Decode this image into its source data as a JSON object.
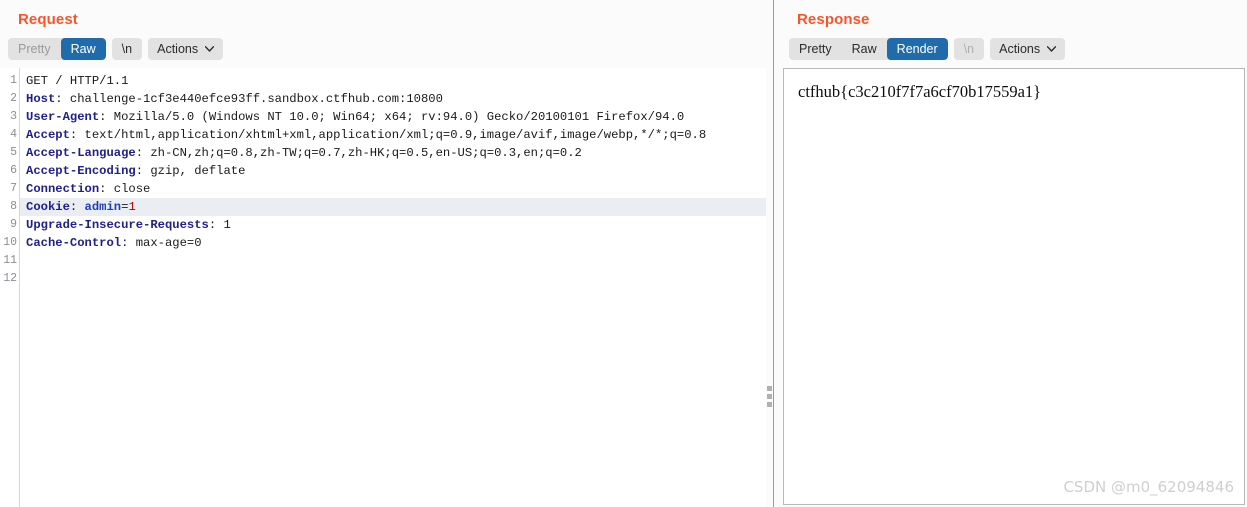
{
  "request": {
    "title": "Request",
    "tabs": [
      {
        "label": "Pretty",
        "state": "muted"
      },
      {
        "label": "Raw",
        "state": "active"
      }
    ],
    "newline_button": "\\n",
    "actions_button": "Actions",
    "line_numbers": [
      "1",
      "2",
      "3",
      "4",
      "5",
      "6",
      "7",
      "8",
      "9",
      "10",
      "11",
      "12"
    ],
    "lines": [
      {
        "n": 1,
        "highlight": false,
        "segments": [
          {
            "text": "GET / HTTP/1.1",
            "style": "plain"
          }
        ]
      },
      {
        "n": 2,
        "highlight": false,
        "segments": [
          {
            "text": "Host",
            "style": "header"
          },
          {
            "text": ": challenge-1cf3e440efce93ff.sandbox.ctfhub.com:10800",
            "style": "plain"
          }
        ]
      },
      {
        "n": 3,
        "highlight": false,
        "segments": [
          {
            "text": "User-Agent",
            "style": "header"
          },
          {
            "text": ": Mozilla/5.0 (Windows NT 10.0; Win64; x64; rv:94.0) Gecko/20100101 Firefox/94.0",
            "style": "plain"
          }
        ]
      },
      {
        "n": 4,
        "highlight": false,
        "segments": [
          {
            "text": "Accept",
            "style": "header"
          },
          {
            "text": ": text/html,application/xhtml+xml,application/xml;q=0.9,image/avif,image/webp,*/*;q=0.8",
            "style": "plain"
          }
        ]
      },
      {
        "n": 5,
        "highlight": false,
        "segments": [
          {
            "text": "Accept-Language",
            "style": "header"
          },
          {
            "text": ": zh-CN,zh;q=0.8,zh-TW;q=0.7,zh-HK;q=0.5,en-US;q=0.3,en;q=0.2",
            "style": "plain"
          }
        ]
      },
      {
        "n": 6,
        "highlight": false,
        "segments": [
          {
            "text": "Accept-Encoding",
            "style": "header"
          },
          {
            "text": ": gzip, deflate",
            "style": "plain"
          }
        ]
      },
      {
        "n": 7,
        "highlight": false,
        "segments": [
          {
            "text": "Connection",
            "style": "header"
          },
          {
            "text": ": close",
            "style": "plain"
          }
        ]
      },
      {
        "n": 8,
        "highlight": true,
        "segments": [
          {
            "text": "Cookie",
            "style": "header"
          },
          {
            "text": ": ",
            "style": "plain"
          },
          {
            "text": "admin",
            "style": "key"
          },
          {
            "text": "=",
            "style": "plain"
          },
          {
            "text": "1",
            "style": "red"
          }
        ]
      },
      {
        "n": 9,
        "highlight": false,
        "segments": [
          {
            "text": "Upgrade-Insecure-Requests",
            "style": "header"
          },
          {
            "text": ": 1",
            "style": "plain"
          }
        ]
      },
      {
        "n": 10,
        "highlight": false,
        "segments": [
          {
            "text": "Cache-Control",
            "style": "header"
          },
          {
            "text": ": max-age=0",
            "style": "plain"
          }
        ]
      },
      {
        "n": 11,
        "highlight": false,
        "segments": []
      },
      {
        "n": 12,
        "highlight": false,
        "segments": []
      }
    ]
  },
  "response": {
    "title": "Response",
    "tabs": [
      {
        "label": "Pretty",
        "state": "normal"
      },
      {
        "label": "Raw",
        "state": "normal"
      },
      {
        "label": "Render",
        "state": "active"
      }
    ],
    "newline_button": "\\n",
    "actions_button": "Actions",
    "rendered_text": "ctfhub{c3c210f7f7a6cf70b17559a1}"
  },
  "watermark": "CSDN @m0_62094846",
  "colors": {
    "accent_title": "#f9552a",
    "active_tab_bg": "#1f6bab",
    "toolbar_bg": "#e2e2e2",
    "highlight_row": "#eaeef3",
    "header_name": "#20208a",
    "cookie_key": "#1f3fb5",
    "cookie_value": "#b00000",
    "watermark": "#cfcfcf"
  }
}
